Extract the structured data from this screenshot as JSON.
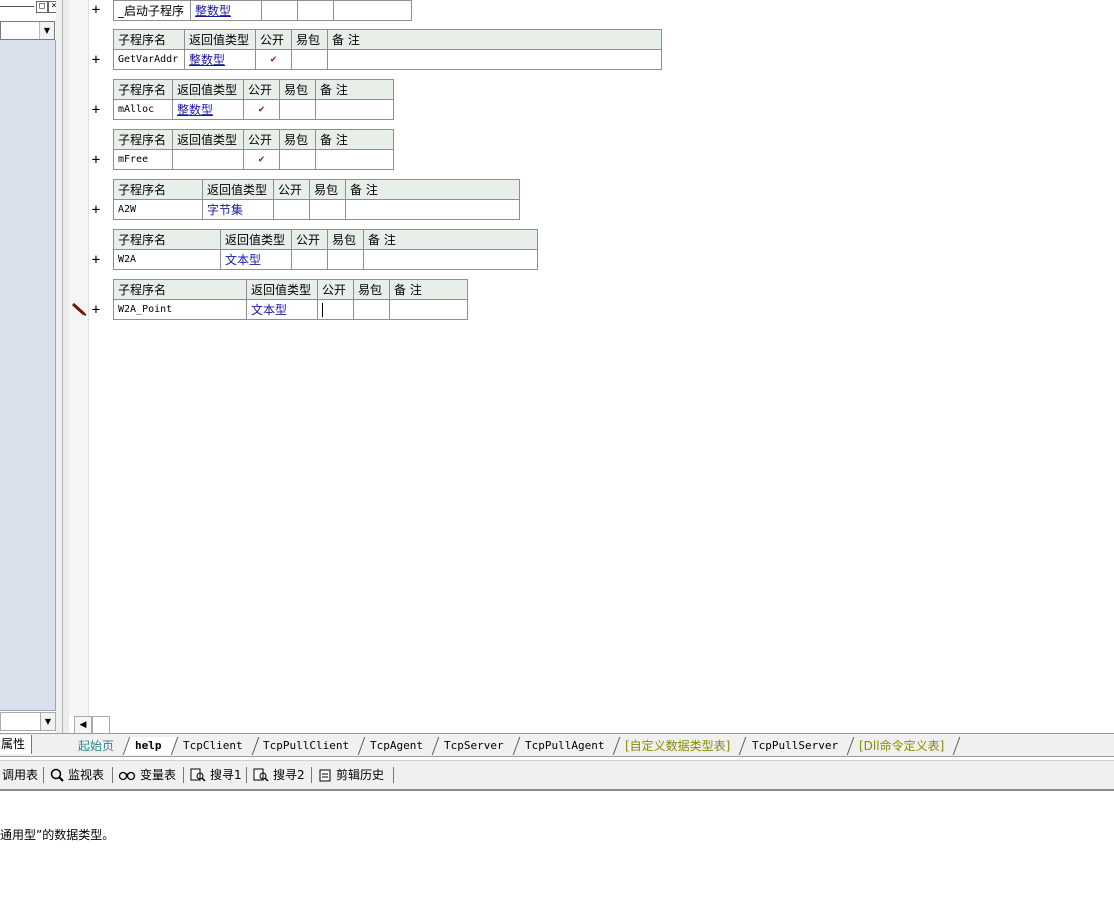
{
  "left_panel": {
    "restore_glyph": "□",
    "close_glyph": "×",
    "tab_label": "属性"
  },
  "headers": {
    "name": "子程序名",
    "ret": "返回值类型",
    "pub": "公开",
    "easy": "易包",
    "note": "备 注"
  },
  "marker": "+",
  "check": "✔",
  "subroutines": [
    {
      "name": "_启动子程序",
      "ret_type": "整数型",
      "public": false,
      "header_visible": false
    },
    {
      "name": "GetVarAddr",
      "ret_type": "整数型",
      "public": true
    },
    {
      "name": "mAlloc",
      "ret_type": "整数型",
      "public": true
    },
    {
      "name": "mFree",
      "ret_type": "",
      "public": true
    },
    {
      "name": "A2W",
      "ret_type": "字节集",
      "public": false
    },
    {
      "name": "W2A",
      "ret_type": "文本型",
      "public": false
    },
    {
      "name": "W2A_Point",
      "ret_type": "文本型",
      "public": false,
      "editing": true
    }
  ],
  "tabs": [
    {
      "label": "起始页",
      "style": "home"
    },
    {
      "label": "help",
      "style": "active"
    },
    {
      "label": "TcpClient"
    },
    {
      "label": "TcpPullClient"
    },
    {
      "label": "TcpAgent"
    },
    {
      "label": "TcpServer"
    },
    {
      "label": "TcpPullAgent"
    },
    {
      "label": "[自定义数据类型表]",
      "style": "olive"
    },
    {
      "label": "TcpPullServer"
    },
    {
      "label": "[Dll命令定义表]",
      "style": "olive"
    }
  ],
  "toolbar": [
    {
      "label": "调用表",
      "icon": "list-icon"
    },
    {
      "label": "监视表",
      "icon": "magnifier-icon"
    },
    {
      "label": "变量表",
      "icon": "binoculars-icon"
    },
    {
      "label": "搜寻1",
      "icon": "search-doc-icon"
    },
    {
      "label": "搜寻2",
      "icon": "search-doc-icon"
    },
    {
      "label": "剪辑历史",
      "icon": "clipboard-icon"
    }
  ],
  "message": "通用型”的数据类型。",
  "colors": {
    "type_text": "#1a1aa0",
    "header_bg": "#e8efe8",
    "check": "#8b1a1a",
    "tree_bg": "#d9e1ec",
    "home_tab": "#2b8a8a",
    "olive_tab": "#8a8a00"
  }
}
